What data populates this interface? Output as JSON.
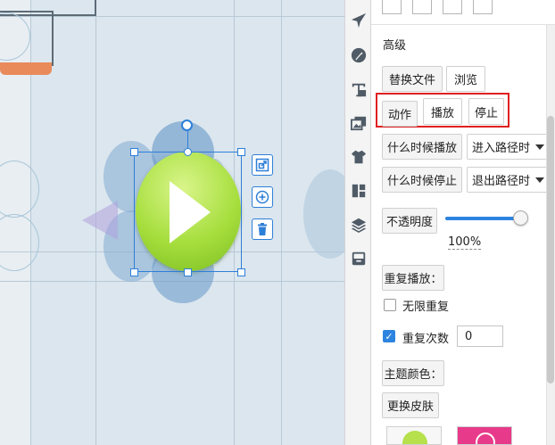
{
  "panel": {
    "advanced_title": "高级",
    "replace_file_label": "替换文件",
    "browse_label": "浏览",
    "action_label": "动作",
    "play_label": "播放",
    "stop_label": "停止",
    "when_play_label": "什么时候播放",
    "when_play_value": "进入路径时",
    "when_stop_label": "什么时候停止",
    "when_stop_value": "退出路径时",
    "opacity_label": "不透明度",
    "opacity_value": "100%",
    "opacity_level": 1.0,
    "repeat_play_label": "重复播放：",
    "infinite_repeat_label": "无限重复",
    "infinite_repeat_checked": false,
    "repeat_count_label": "重复次数",
    "repeat_count_checked": true,
    "repeat_count_value": "0",
    "theme_color_label": "主题颜色：",
    "change_skin_label": "更换皮肤"
  },
  "toolbar": {
    "icons": [
      "airplane-icon",
      "wrench-icon",
      "text-icon",
      "image-icon",
      "shirt-icon",
      "layout-icon",
      "layers-icon",
      "archive-icon"
    ]
  },
  "canvas": {
    "selected_object": "play-button",
    "float_buttons": [
      "duplicate-icon",
      "add-circle-icon",
      "trash-icon"
    ]
  },
  "colors": {
    "accent": "#2d84e0",
    "highlight_frame": "#e02020",
    "play_green": "#a6de3d",
    "canvas_bg": "#dbe6ee"
  }
}
